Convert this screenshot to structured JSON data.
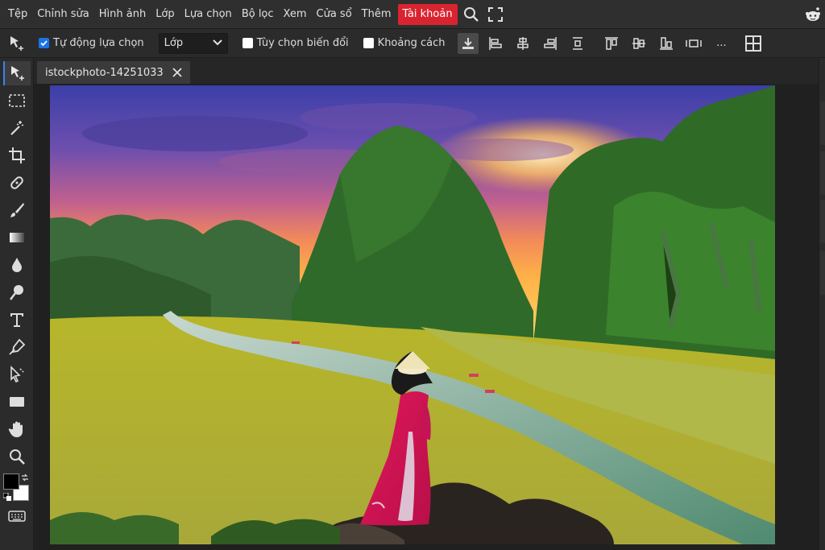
{
  "menu": {
    "items": [
      "Tệp",
      "Chỉnh sửa",
      "Hình ảnh",
      "Lớp",
      "Lựa chọn",
      "Bộ lọc",
      "Xem",
      "Cửa sổ",
      "Thêm"
    ],
    "account": "Tài khoản",
    "accent": "#d9242f"
  },
  "options": {
    "auto_select_label": "Tự động lựa chọn",
    "auto_select_checked": true,
    "layer_select_value": "Lớp",
    "transform_label": "Tùy chọn biến đổi",
    "transform_checked": false,
    "spacing_label": "Khoảng cách",
    "spacing_checked": false,
    "more_label": "..."
  },
  "document": {
    "tab_title": "istockphoto-14251033"
  },
  "tools": [
    "move-tool",
    "marquee-tool",
    "magic-wand-tool",
    "crop-tool",
    "healing-tool",
    "brush-tool",
    "gradient-tool",
    "blur-tool",
    "dodge-tool",
    "type-tool",
    "pen-tool",
    "path-select-tool",
    "shape-tool",
    "hand-tool",
    "zoom-tool"
  ],
  "colors": {
    "foreground": "#000000",
    "background": "#ffffff",
    "accent_blue": "#3b82f6"
  }
}
